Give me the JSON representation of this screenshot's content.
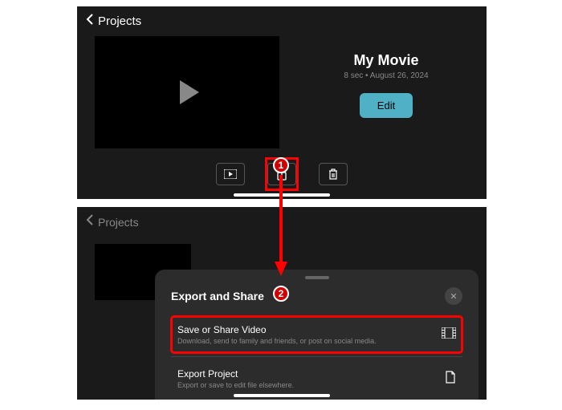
{
  "top": {
    "back_label": "Projects",
    "movie_title": "My Movie",
    "movie_sub": "8 sec • August 26, 2024",
    "edit_label": "Edit"
  },
  "bottom": {
    "back_label": "Projects",
    "sheet_title": "Export and Share",
    "item1_title": "Save or Share Video",
    "item1_sub": "Download, send to family and friends, or post on social media.",
    "item2_title": "Export Project",
    "item2_sub": "Export or save to edit file elsewhere."
  },
  "annot": {
    "badge1": "1",
    "badge2": "2"
  }
}
